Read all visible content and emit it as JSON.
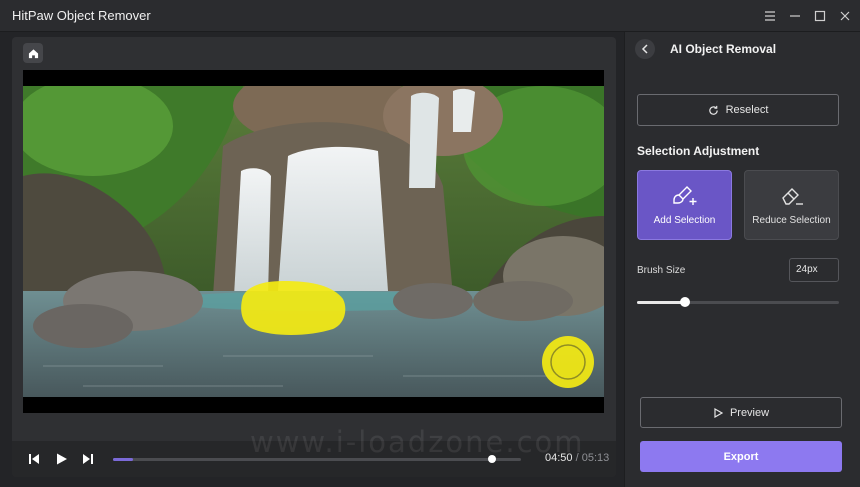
{
  "window": {
    "title": "HitPaw Object Remover",
    "controls": [
      "menu-icon",
      "minimize-icon",
      "maximize-icon",
      "close-icon"
    ]
  },
  "player": {
    "current_time": "04:50",
    "separator": "/",
    "total_time": "05:13",
    "progress_fraction": 0.93,
    "in_point_fraction": 0.05,
    "icons": [
      "home-icon",
      "step-back-icon",
      "play-icon",
      "step-forward-icon"
    ]
  },
  "panel": {
    "title": "AI Object Removal",
    "reselect_label": "Reselect",
    "section_title": "Selection Adjustment",
    "add_selection_label": "Add Selection",
    "reduce_selection_label": "Reduce Selection",
    "brush_size_label": "Brush Size",
    "brush_size_value": "24px",
    "brush_size_fraction": 0.24,
    "preview_label": "Preview",
    "export_label": "Export"
  },
  "watermark": "www.i-loadzone.com",
  "colors": {
    "accent": "#8d79f0",
    "active_tool": "#6a56c6",
    "selection_highlight": "#f4ea12"
  }
}
